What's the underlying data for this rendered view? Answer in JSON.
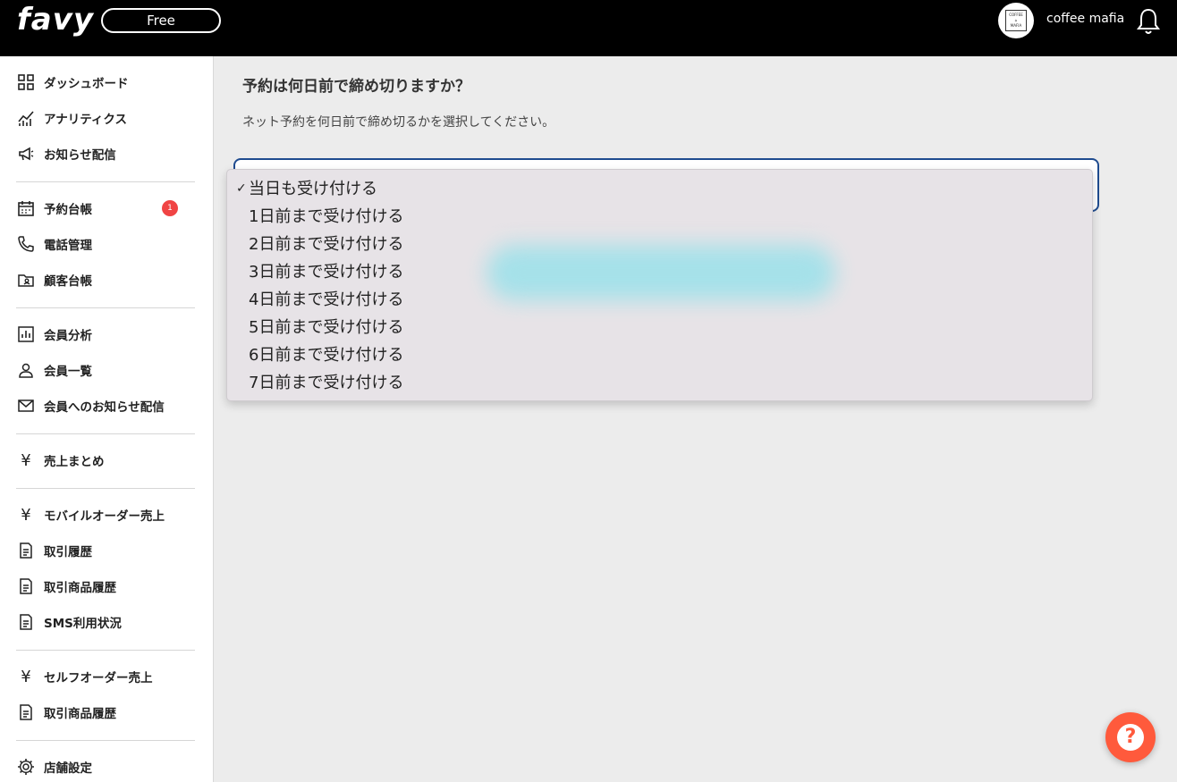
{
  "header": {
    "logo": "favy",
    "plan": "Free",
    "store_name": "coffee mafia",
    "avatar_text_top": "COFFEE",
    "avatar_text_bottom": "MAFIA"
  },
  "sidebar": {
    "items": [
      {
        "label": "ダッシュボード",
        "icon": "dashboard-icon"
      },
      {
        "label": "アナリティクス",
        "icon": "analytics-icon"
      },
      {
        "label": "お知らせ配信",
        "icon": "megaphone-icon"
      },
      {
        "label": "予約台帳",
        "icon": "calendar-icon",
        "badge": "1"
      },
      {
        "label": "電話管理",
        "icon": "phone-icon"
      },
      {
        "label": "顧客台帳",
        "icon": "contact-folder-icon"
      },
      {
        "label": "会員分析",
        "icon": "bar-chart-icon"
      },
      {
        "label": "会員一覧",
        "icon": "user-icon"
      },
      {
        "label": "会員へのお知らせ配信",
        "icon": "mail-icon"
      },
      {
        "label": "売上まとめ",
        "icon": "yen-icon"
      },
      {
        "label": "モバイルオーダー売上",
        "icon": "yen-icon"
      },
      {
        "label": "取引履歴",
        "icon": "document-icon"
      },
      {
        "label": "取引商品履歴",
        "icon": "document-icon"
      },
      {
        "label": "SMS利用状況",
        "icon": "document-icon"
      },
      {
        "label": "セルフオーダー売上",
        "icon": "yen-icon"
      },
      {
        "label": "取引商品履歴",
        "icon": "document-icon"
      },
      {
        "label": "店舗設定",
        "icon": "gear-icon"
      }
    ]
  },
  "main": {
    "title": "予約は何日前で締め切りますか？",
    "description": "ネット予約を何日前で締め切るかを選択してください。",
    "dropdown": {
      "check_mark": "✓",
      "options": [
        {
          "label": "当日も受け付ける",
          "selected": true
        },
        {
          "label": "1日前まで受け付ける",
          "selected": false
        },
        {
          "label": "2日前まで受け付ける",
          "selected": false
        },
        {
          "label": "3日前まで受け付ける",
          "selected": false
        },
        {
          "label": "4日前まで受け付ける",
          "selected": false
        },
        {
          "label": "5日前まで受け付ける",
          "selected": false
        },
        {
          "label": "6日前まで受け付ける",
          "selected": false
        },
        {
          "label": "7日前まで受け付ける",
          "selected": false
        }
      ]
    }
  },
  "help_button": {
    "label": "?",
    "color": "#ff5a3c"
  }
}
